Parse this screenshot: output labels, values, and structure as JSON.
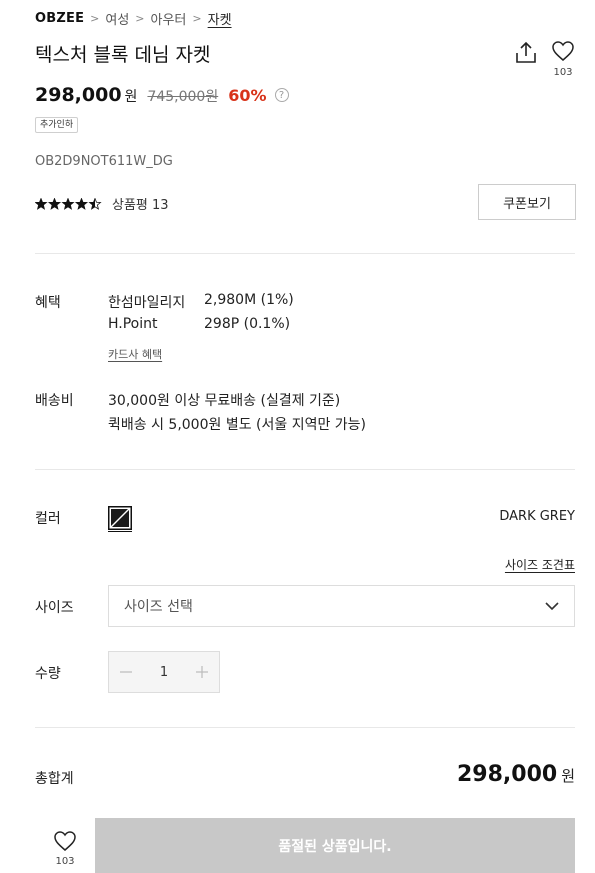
{
  "breadcrumb": {
    "brand": "OBZEE",
    "items": [
      "여성",
      "아우터",
      "자켓"
    ]
  },
  "product": {
    "title": "텍스처 블록 데님 자켓",
    "like_count": "103",
    "price": "298,000",
    "price_unit": "원",
    "original_price": "745,000원",
    "discount": "60%",
    "badge": "추가인하",
    "code": "OB2D9NOT611W_DG",
    "rating": 4.5,
    "review_label": "상품평 13",
    "coupon_button": "쿠폰보기"
  },
  "benefits": {
    "label": "혜택",
    "rows": [
      {
        "name": "한섬마일리지",
        "value": "2,980M (1%)"
      },
      {
        "name": "H.Point",
        "value": "298P (0.1%)"
      }
    ],
    "card_link": "카드사 혜택"
  },
  "shipping": {
    "label": "배송비",
    "line1": "30,000원 이상 무료배송 (실결제 기준)",
    "line2": "퀵배송 시 5,000원 별도 (서울 지역만 가능)"
  },
  "color": {
    "label": "컬러",
    "selected_name": "DARK GREY",
    "swatch_color": "#1a1a1a"
  },
  "size": {
    "guide_link": "사이즈 조견표",
    "label": "사이즈",
    "placeholder": "사이즈 선택"
  },
  "quantity": {
    "label": "수량",
    "value": "1"
  },
  "total": {
    "label": "총합계",
    "amount": "298,000",
    "unit": "원"
  },
  "footer": {
    "like_count": "103",
    "soldout_label": "품절된 상품입니다."
  },
  "colors": {
    "discount": "#d8331a",
    "soldout_bg": "#c8c8c8"
  }
}
